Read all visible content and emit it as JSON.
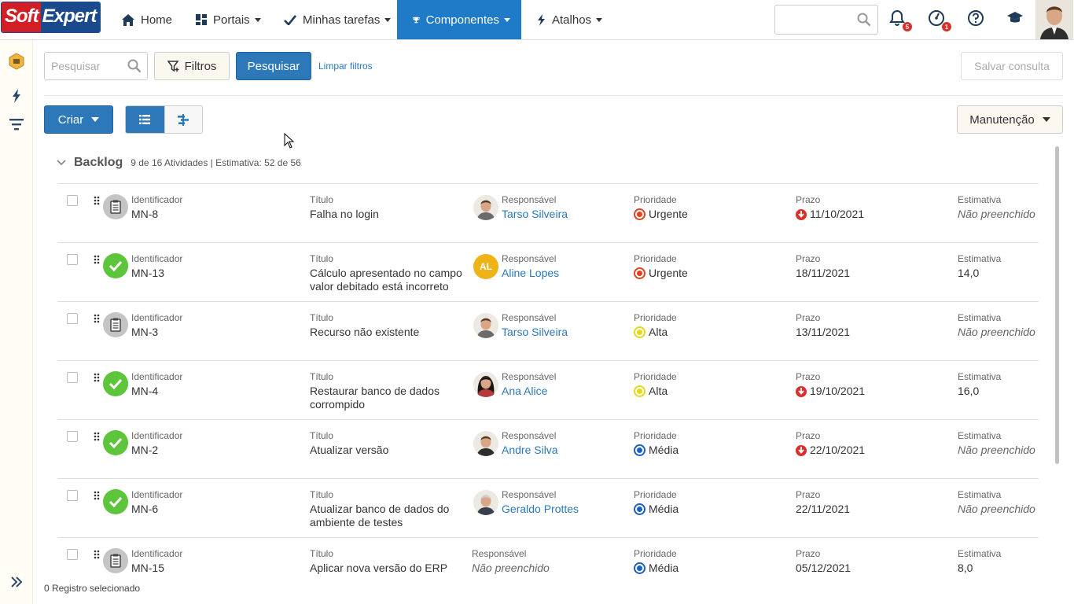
{
  "brand": {
    "soft": "Soft",
    "expert": "Expert"
  },
  "nav": {
    "home": "Home",
    "portais": "Portais",
    "tarefas": "Minhas tarefas",
    "componentes": "Componentes",
    "atalhos": "Atalhos",
    "notifications_count": "5",
    "alerts_count": "1"
  },
  "filters": {
    "search_placeholder": "Pesquisar",
    "filtros_label": "Filtros",
    "pesquisar_label": "Pesquisar",
    "limpar_label": "Limpar filtros",
    "salvar_label": "Salvar consulta"
  },
  "toolbar": {
    "criar_label": "Criar",
    "manutencao_label": "Manutenção"
  },
  "backlog": {
    "title": "Backlog",
    "meta": "9 de 16 Atividades | Estimativa: 52 de 56"
  },
  "labels": {
    "id": "Identificador",
    "title": "Título",
    "resp": "Responsável",
    "prio": "Prioridade",
    "prazo": "Prazo",
    "est": "Estimativa"
  },
  "rows": [
    {
      "status": "doc",
      "id": "MN-8",
      "title": "Falha no login",
      "resp": "Tarso Silveira",
      "resp_avatar": "man-short-hair",
      "prio": "Urgente",
      "prio_color": "#e0411f",
      "prazo": "11/10/2021",
      "late": true,
      "est": "Não preenchido",
      "est_empty": true
    },
    {
      "status": "ok",
      "id": "MN-13",
      "title": "Cálculo apresentado no campo valor debitado está incorreto",
      "resp": "Aline Lopes",
      "resp_initials": "AL",
      "prio": "Urgente",
      "prio_color": "#e0411f",
      "prazo": "18/11/2021",
      "late": false,
      "est": "14,0",
      "est_empty": false
    },
    {
      "status": "doc",
      "id": "MN-3",
      "title": "Recurso não existente",
      "resp": "Tarso Silveira",
      "resp_avatar": "man-short-hair",
      "prio": "Alta",
      "prio_color": "#e6d81c",
      "prazo": "13/11/2021",
      "late": false,
      "est": "Não preenchido",
      "est_empty": true
    },
    {
      "status": "ok",
      "id": "MN-4",
      "title": "Restaurar banco de dados corrompido",
      "resp": "Ana Alice",
      "resp_avatar": "woman-dark-hair",
      "prio": "Alta",
      "prio_color": "#e6d81c",
      "prazo": "19/10/2021",
      "late": true,
      "est": "16,0",
      "est_empty": false
    },
    {
      "status": "ok",
      "id": "MN-2",
      "title": "Atualizar versão",
      "resp": "Andre Silva",
      "resp_avatar": "man-suit",
      "prio": "Média",
      "prio_color": "#1c5fbf",
      "prazo": "22/10/2021",
      "late": true,
      "est": "Não preenchido",
      "est_empty": true
    },
    {
      "status": "ok",
      "id": "MN-6",
      "title": "Atualizar banco de dados do ambiente de testes",
      "resp": "Geraldo Prottes",
      "resp_avatar": "man-suit-tie",
      "prio": "Média",
      "prio_color": "#1c5fbf",
      "prazo": "22/11/2021",
      "late": false,
      "est": "Não preenchido",
      "est_empty": true
    },
    {
      "status": "doc",
      "id": "MN-15",
      "title": "Aplicar nova versão do ERP",
      "resp": "Não preenchido",
      "resp_empty": true,
      "prio": "Média",
      "prio_color": "#1c5fbf",
      "prazo": "05/12/2021",
      "late": false,
      "est": "8,0",
      "est_empty": false
    }
  ],
  "footer": {
    "selected": "0 Registro selecionado"
  },
  "colors": {
    "primary": "#2c78b8",
    "active_nav": "#1f7ac7",
    "ok": "#5cc53b",
    "late": "#d9302c"
  }
}
